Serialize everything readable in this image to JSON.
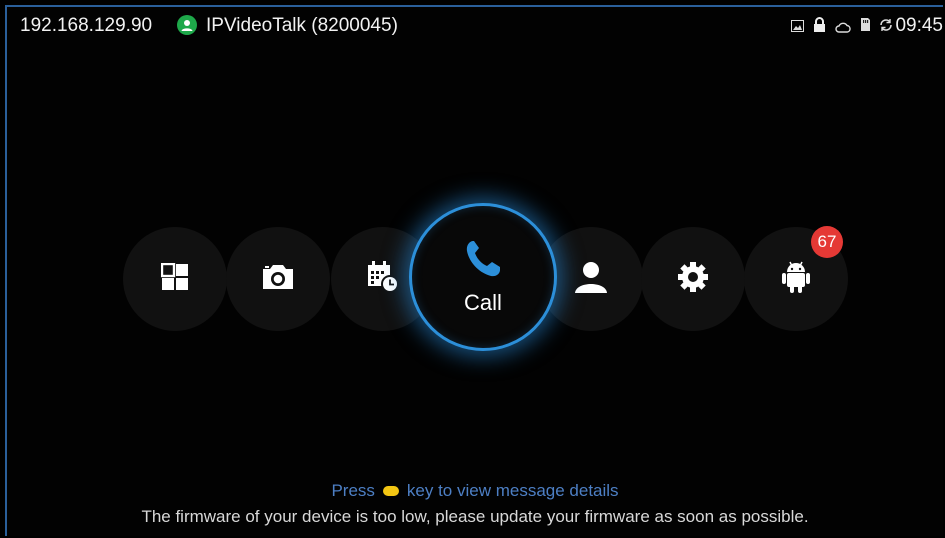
{
  "status_bar": {
    "ip_address": "192.168.129.90",
    "account": "IPVideoTalk (8200045)",
    "time": "09:45",
    "icons": [
      "picture-icon",
      "lock-icon",
      "cloud-icon",
      "sd-card-icon",
      "sync-icon"
    ]
  },
  "dock": {
    "items": [
      {
        "name": "apps",
        "icon": "apps-grid-icon"
      },
      {
        "name": "camera",
        "icon": "camera-icon"
      },
      {
        "name": "schedule",
        "icon": "calendar-clock-icon"
      },
      {
        "name": "call",
        "icon": "phone-icon",
        "label": "Call"
      },
      {
        "name": "contacts",
        "icon": "person-icon"
      },
      {
        "name": "settings",
        "icon": "gear-icon"
      },
      {
        "name": "android-apps",
        "icon": "android-icon",
        "badge": "67"
      }
    ]
  },
  "messages": {
    "hint_before": "Press",
    "hint_after": "key to view message details",
    "firmware_warning": "The firmware of your device is too low, please update your firmware as soon as possible."
  },
  "colors": {
    "accent_blue": "#2c8fd9",
    "badge_red": "#e53935",
    "account_green": "#1ea84a",
    "hint_blue": "#4d7fc4",
    "key_yellow": "#f3c613"
  }
}
